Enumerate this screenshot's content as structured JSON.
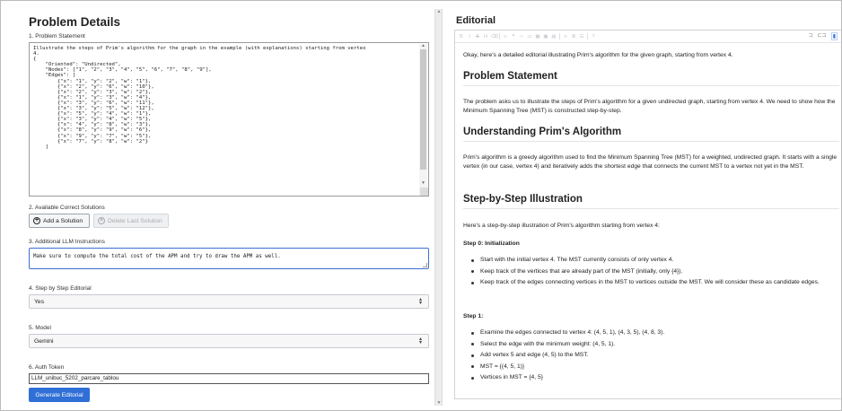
{
  "left": {
    "title": "Problem Details",
    "problem_statement_label": "1. Problem Statement",
    "problem_statement_line1": "Illustrate the steps of Prim's algorithm for the graph in the example (with explanations) starting from vertex",
    "problem_statement_line2": "4.",
    "json_lines": [
      "{",
      "    \"Oriented\": \"Undirected\",",
      "    \"Nodes\": [\"1\", \"2\", \"3\", \"4\", \"5\", \"6\", \"7\", \"8\", \"9\"],",
      "    \"Edges\": [",
      "        {\"x\": \"1\", \"y\": \"2\", \"w\": \"1\"},",
      "        {\"x\": \"2\", \"y\": \"6\", \"w\": \"10\"},",
      "        {\"x\": \"2\", \"y\": \"3\", \"w\": \"2\"},",
      "        {\"x\": \"1\", \"y\": \"3\", \"w\": \"4\"},",
      "        {\"x\": \"3\", \"y\": \"6\", \"w\": \"11\"},",
      "        {\"x\": \"3\", \"y\": \"5\", \"w\": \"12\"},",
      "        {\"x\": \"5\", \"y\": \"4\", \"w\": \"1\"},",
      "        {\"x\": \"3\", \"y\": \"4\", \"w\": \"5\"},",
      "        {\"x\": \"4\", \"y\": \"8\", \"w\": \"3\"},",
      "        {\"x\": \"8\", \"y\": \"9\", \"w\": \"6\"},",
      "        {\"x\": \"9\", \"y\": \"7\", \"w\": \"5\"},",
      "        {\"x\": \"7\", \"y\": \"8\", \"w\": \"2\"}",
      "    ]"
    ],
    "solutions_label": "2. Available Correct Solutions",
    "add_solution": "Add a Solution",
    "delete_last_solution": "Delete Last Solution",
    "llm_label": "3. Additional LLM Instructions",
    "llm_value": "Make sure to compute the total cost of the APM and try to draw the APM as well.",
    "step_label": "4. Step by Step Editorial",
    "step_value": "Yes",
    "model_label": "5. Model",
    "model_value": "Gemini",
    "auth_label": "6. Auth Token",
    "auth_value": "LLM_unibuc_5202_parcare_tablou",
    "generate": "Generate Editorial"
  },
  "editorial": {
    "title": "Editorial",
    "intro": "Okay, here's a detailed editorial illustrating Prim's algorithm for the given graph, starting from vertex 4.",
    "h_problem": "Problem Statement",
    "p_problem": "The problem asks us to illustrate the steps of Prim's algorithm for a given undirected graph, starting from vertex 4. We need to show how the Minimum Spanning Tree (MST) is constructed step-by-step.",
    "h_understanding": "Understanding Prim's Algorithm",
    "p_understanding": "Prim's algorithm is a greedy algorithm used to find the Minimum Spanning Tree (MST) for a weighted, undirected graph. It starts with a single vertex (in our case, vertex 4) and iteratively adds the shortest edge that connects the current MST to a vertex not yet in the MST.",
    "h_steps": "Step-by-Step Illustration",
    "p_steps": "Here's a step-by-step illustration of Prim's algorithm starting from vertex 4:",
    "step0_title": "Step 0: Initialization",
    "step0_items": [
      "Start with the initial vertex 4. The MST currently consists of only vertex 4.",
      "Keep track of the vertices that are already part of the MST (initially, only {4}).",
      "Keep track of the edges connecting vertices in the MST to vertices outside the MST. We will consider these as candidate edges."
    ],
    "step1_title": "Step 1:",
    "step1_items": [
      "Examine the edges connected to vertex 4: (4, 5, 1), (4, 3, 5), (4, 8, 3).",
      "Select the edge with the minimum weight: (4, 5, 1).",
      "Add vertex 5 and edge (4, 5) to the MST.",
      "MST = {(4, 5, 1)}",
      "Vertices in MST = {4, 5}"
    ]
  },
  "colors": {
    "accent": "#2f6fd6",
    "border": "#cfd3d8"
  },
  "icons": [
    "plus-circle-icon",
    "x-circle-icon",
    "chevron-updown-icon",
    "bold-icon",
    "italic-icon",
    "code-view-icon",
    "split-view-icon",
    "preview-icon"
  ]
}
